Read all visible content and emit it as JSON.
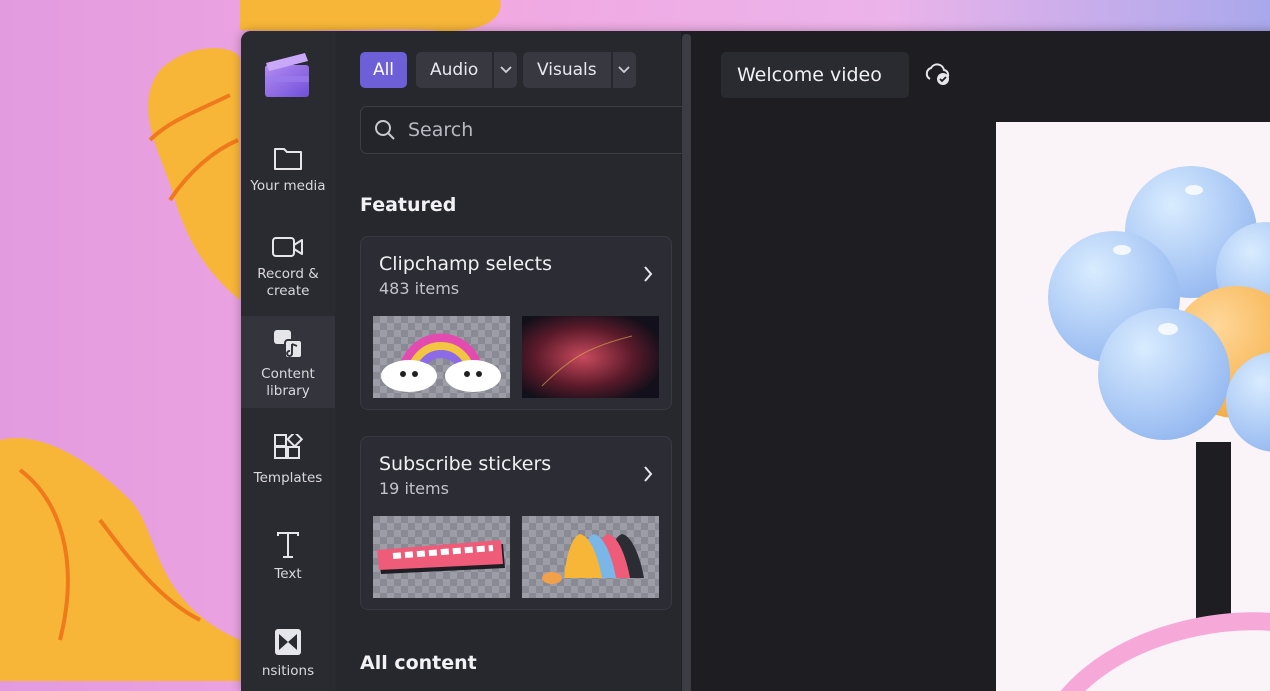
{
  "nav": {
    "items": [
      {
        "label": "Your media",
        "icon": "folder-icon"
      },
      {
        "label": "Record & create",
        "icon": "video-camera-icon"
      },
      {
        "label": "Content library",
        "icon": "content-library-icon",
        "active": true
      },
      {
        "label": "Templates",
        "icon": "templates-icon"
      },
      {
        "label": "Text",
        "icon": "text-icon"
      },
      {
        "label": "nsitions",
        "icon": "transitions-icon"
      }
    ]
  },
  "filters": {
    "all": "All",
    "audio": "Audio",
    "visuals": "Visuals"
  },
  "search": {
    "placeholder": "Search"
  },
  "featured": {
    "heading": "Featured",
    "cards": [
      {
        "title": "Clipchamp selects",
        "count": "483 items"
      },
      {
        "title": "Subscribe stickers",
        "count": "19 items"
      }
    ]
  },
  "all_content": {
    "heading": "All content"
  },
  "project": {
    "title": "Welcome video",
    "save_status_icon": "cloud-check-icon"
  },
  "colors": {
    "accent": "#6c5fd8",
    "panel": "#27272e",
    "rail": "#2a2a31"
  }
}
